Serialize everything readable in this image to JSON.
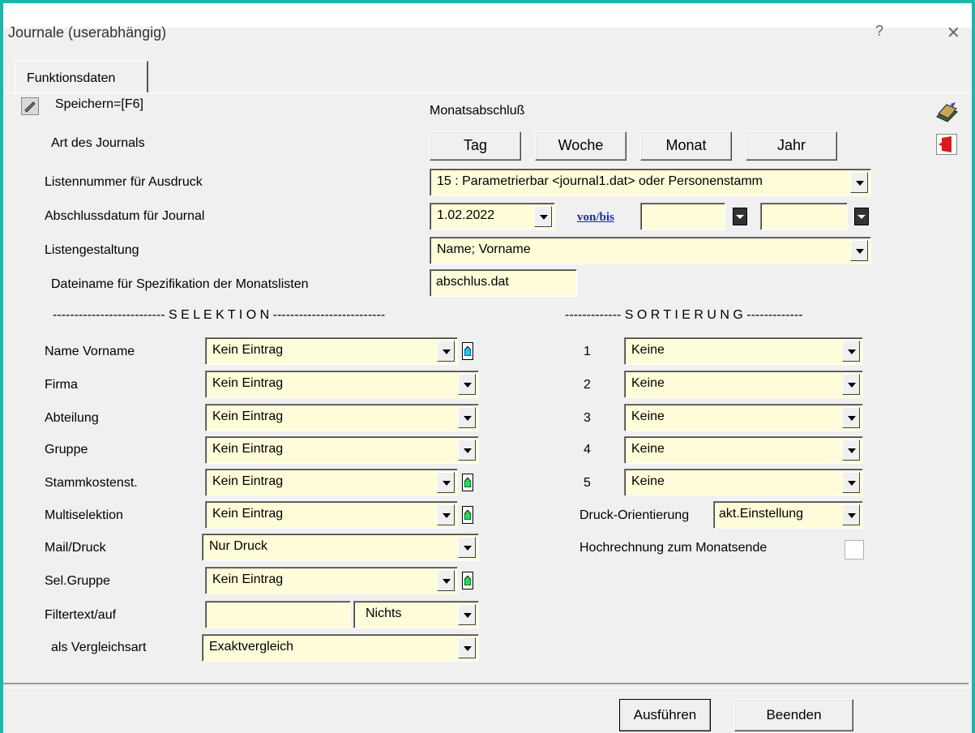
{
  "window": {
    "title": "Journale (userabhängig)",
    "help_glyph": "?",
    "close_glyph": "✕"
  },
  "tab": {
    "label": "Funktionsdaten"
  },
  "save": {
    "label": "Speichern=[F6]"
  },
  "monatsabschluss": {
    "label": "Monatsabschluß"
  },
  "art": {
    "label": "Art des Journals",
    "buttons": [
      "Tag",
      "Woche",
      "Monat",
      "Jahr"
    ]
  },
  "listennummer": {
    "label": "Listennummer für Ausdruck",
    "value": "15 : Parametrierbar <journal1.dat> oder Personenstamm"
  },
  "abschlussdatum": {
    "label": "Abschlussdatum für Journal",
    "value": "1.02.2022",
    "link": "von/bis",
    "from": "",
    "to": ""
  },
  "listengestaltung": {
    "label": "Listengestaltung",
    "value": "Name; Vorname"
  },
  "dateiname": {
    "label": "Dateiname für Spezifikation der Monatslisten",
    "value": "abschlus.dat"
  },
  "selektion": {
    "header": "-------------------------- S E L E K T I O N --------------------------",
    "rows": [
      {
        "label": "Name Vorname",
        "value": "Kein Eintrag"
      },
      {
        "label": "Firma",
        "value": "Kein Eintrag"
      },
      {
        "label": "Abteilung",
        "value": "Kein Eintrag"
      },
      {
        "label": "Gruppe",
        "value": "Kein Eintrag"
      },
      {
        "label": "Stammkostenst.",
        "value": "Kein Eintrag"
      },
      {
        "label": "Multiselektion",
        "value": "Kein Eintrag"
      },
      {
        "label": "Mail/Druck",
        "value": "Nur Druck"
      },
      {
        "label": "Sel.Gruppe",
        "value": "Kein Eintrag"
      }
    ],
    "filter": {
      "label": "Filtertext/auf",
      "text": "",
      "value": "Nichts"
    },
    "vergleich": {
      "label": "als Vergleichsart",
      "value": "Exaktvergleich"
    }
  },
  "sortierung": {
    "header": "------------- S O R T I E R U N G -------------",
    "rows": [
      {
        "num": "1",
        "value": "Keine"
      },
      {
        "num": "2",
        "value": "Keine"
      },
      {
        "num": "3",
        "value": "Keine"
      },
      {
        "num": "4",
        "value": "Keine"
      },
      {
        "num": "5",
        "value": "Keine"
      }
    ],
    "druck": {
      "label": "Druck-Orientierung",
      "value": "akt.Einstellung"
    },
    "hochrechnung": {
      "label": "Hochrechnung zum Monatsende",
      "checked": false
    }
  },
  "footer": {
    "run": "Ausführen",
    "exit": "Beenden"
  },
  "colors": {
    "border": "#1fb5ac",
    "field": "#fffcd9",
    "link": "#1a2ea0",
    "house_blue": "#19c6ff",
    "house_green": "#22dd55"
  }
}
